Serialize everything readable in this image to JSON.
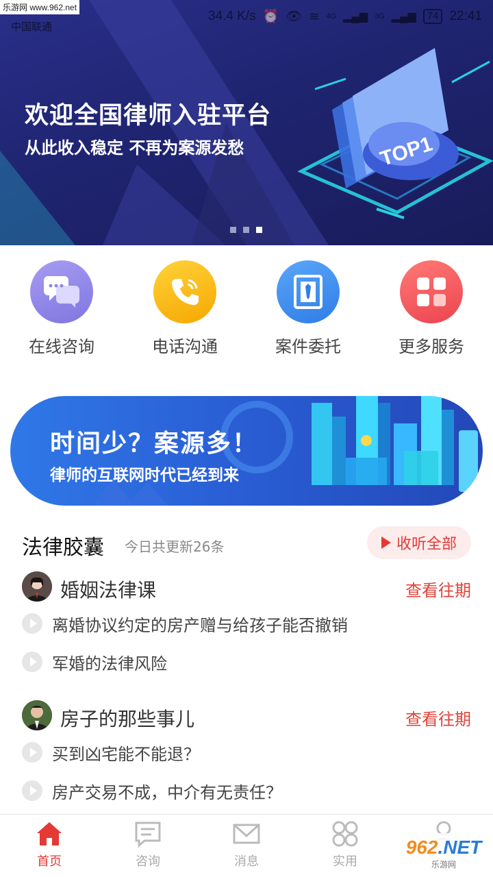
{
  "status_bar": {
    "watermark": "乐游网 www.962.net",
    "carrier": "中国联通",
    "speed": "34.4 K/s",
    "network_1": "4G",
    "network_2": "3G",
    "battery": "74",
    "time": "22:41"
  },
  "banner": {
    "title": "欢迎全国律师入驻平台",
    "subtitle": "从此收入稳定 不再为案源发愁",
    "badge": "TOP1",
    "dots": 3,
    "active_dot": 3
  },
  "services": [
    {
      "label": "在线咨询",
      "icon": "chat-bubbles-icon",
      "color": "#8f86e8"
    },
    {
      "label": "电话沟通",
      "icon": "phone-icon",
      "color": "#f7b500"
    },
    {
      "label": "案件委托",
      "icon": "briefcase-tie-icon",
      "color": "#3f8ef0"
    },
    {
      "label": "更多服务",
      "icon": "grid-icon",
      "color": "#f0545a"
    }
  ],
  "promo": {
    "title": "时间少？案源多！",
    "subtitle": "律师的互联网时代已经到来"
  },
  "legal_capsule": {
    "title": "法律胶囊",
    "count_text": "今日共更新26条",
    "listen_all": "收听全部",
    "courses": [
      {
        "name": "婚姻法律课",
        "view_past": "查看往期",
        "episodes": [
          "离婚协议约定的房产赠与给孩子能否撤销",
          "军婚的法律风险"
        ]
      },
      {
        "name": "房子的那些事儿",
        "view_past": "查看往期",
        "episodes": [
          "买到凶宅能不能退？",
          "房产交易不成，中介有无责任？"
        ]
      }
    ]
  },
  "bottom_nav": [
    {
      "label": "首页",
      "icon": "home-icon",
      "active": true
    },
    {
      "label": "咨询",
      "icon": "consult-icon",
      "active": false
    },
    {
      "label": "消息",
      "icon": "mail-icon",
      "active": false
    },
    {
      "label": "实用",
      "icon": "tools-icon",
      "active": false
    },
    {
      "label": "",
      "icon": "profile-icon",
      "active": false
    }
  ],
  "watermark": {
    "brand": "962",
    "suffix": ".NET",
    "name": "乐游网"
  }
}
